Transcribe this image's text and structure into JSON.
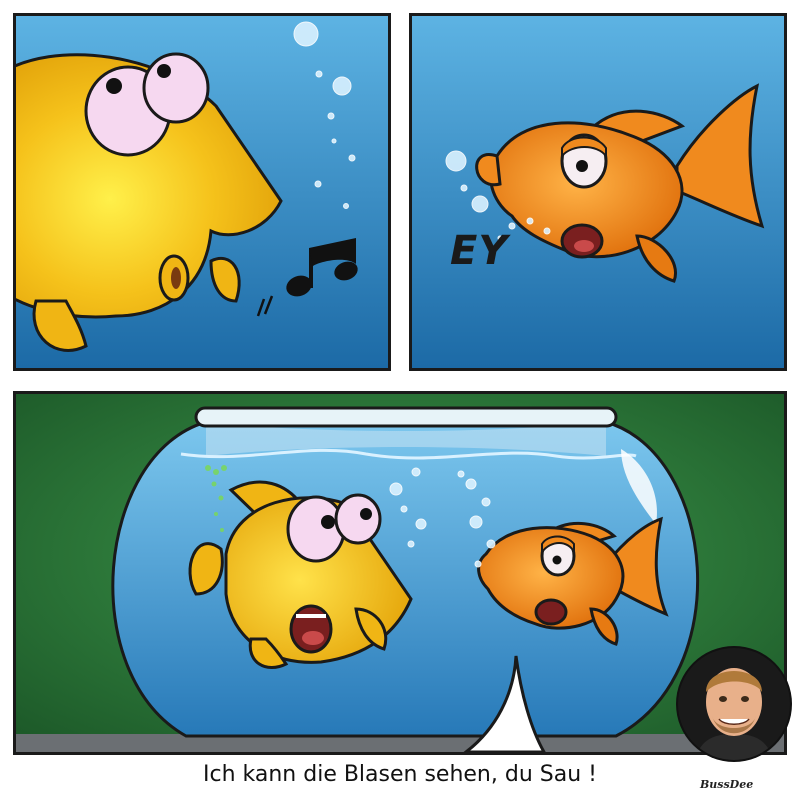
{
  "panel2": {
    "sound_text": "EY"
  },
  "caption": {
    "text": "Ich kann die Blasen sehen, du Sau !"
  },
  "signature": {
    "text": "BussDee"
  },
  "colors": {
    "water": "#2f8fc7",
    "water_dark": "#1f6fa8",
    "wall_green": "#2c7a3a",
    "yellow_fish": "#f5c21b",
    "orange_fish": "#f08a1e",
    "outline": "#1a1a1a"
  },
  "icons": [
    "music-note-icon",
    "bubbles",
    "yellow-fish",
    "orange-fish",
    "fishbowl",
    "speech-bubble-tail",
    "artist-avatar"
  ]
}
